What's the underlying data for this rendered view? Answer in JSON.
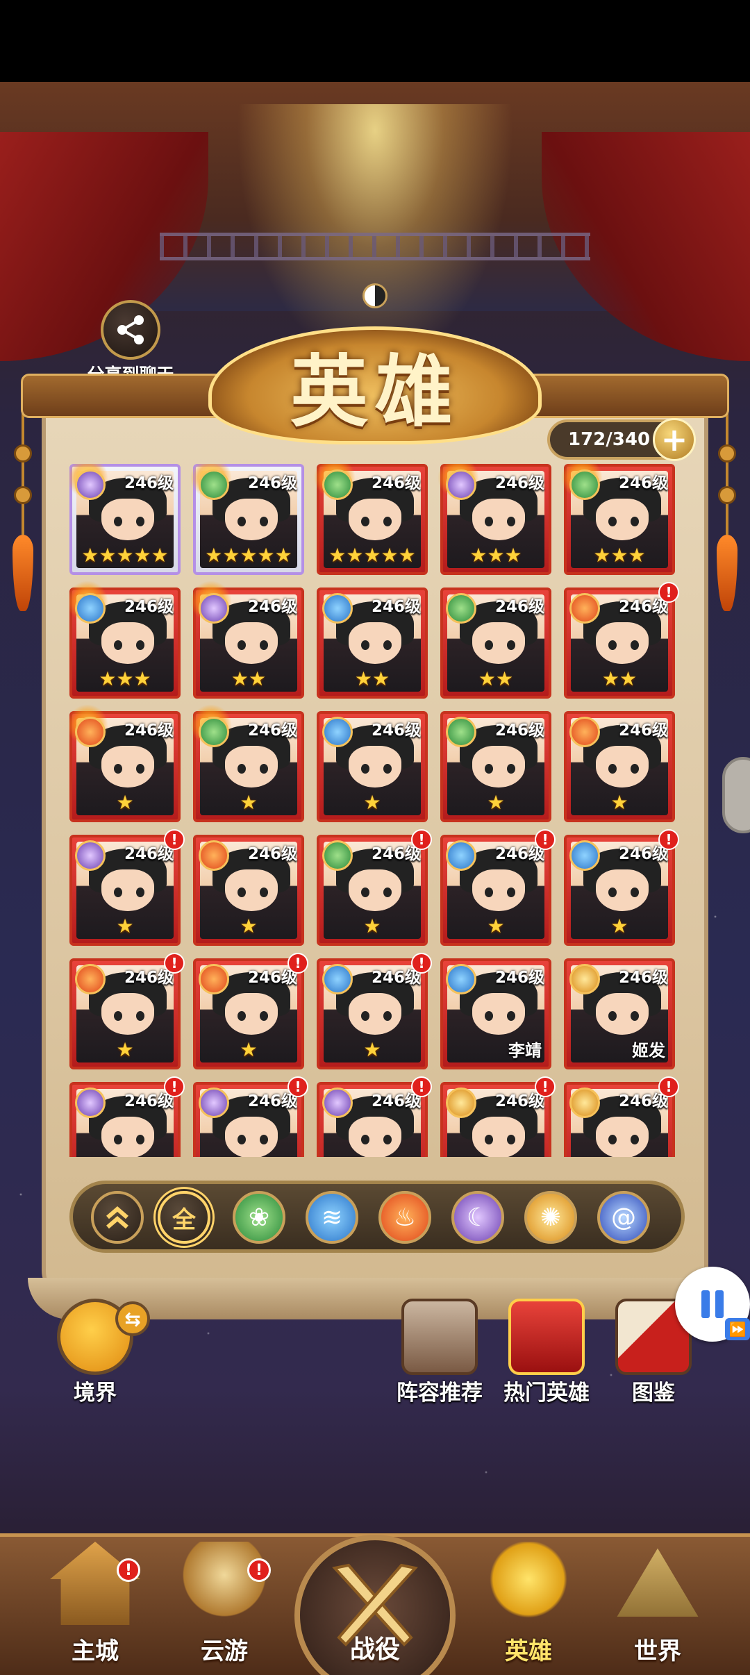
{
  "share": {
    "label": "分享到聊天",
    "icon": "share-icon"
  },
  "title": "英雄",
  "hero_count": "172/340",
  "add_icon": "plus-icon",
  "heroes": [
    {
      "level": "246级",
      "element": "moon",
      "stars": "★★★★★",
      "rarity": "pink",
      "flame": true,
      "alert": false,
      "name": ""
    },
    {
      "level": "246级",
      "element": "wood",
      "stars": "★★★★★",
      "rarity": "pink",
      "flame": true,
      "alert": false,
      "name": ""
    },
    {
      "level": "246级",
      "element": "wood",
      "stars": "★★★★★",
      "rarity": "red",
      "flame": true,
      "alert": false,
      "name": ""
    },
    {
      "level": "246级",
      "element": "moon",
      "stars": "★★★",
      "rarity": "red",
      "flame": true,
      "alert": false,
      "name": ""
    },
    {
      "level": "246级",
      "element": "wood",
      "stars": "★★★",
      "rarity": "red",
      "flame": true,
      "alert": false,
      "name": ""
    },
    {
      "level": "246级",
      "element": "water",
      "stars": "★★★",
      "rarity": "red",
      "flame": true,
      "alert": false,
      "name": ""
    },
    {
      "level": "246级",
      "element": "moon",
      "stars": "★★",
      "rarity": "red",
      "flame": true,
      "alert": false,
      "name": ""
    },
    {
      "level": "246级",
      "element": "water",
      "stars": "★★",
      "rarity": "red",
      "flame": false,
      "alert": false,
      "name": ""
    },
    {
      "level": "246级",
      "element": "wood",
      "stars": "★★",
      "rarity": "red",
      "flame": false,
      "alert": false,
      "name": ""
    },
    {
      "level": "246级",
      "element": "fire",
      "stars": "★★",
      "rarity": "red",
      "flame": false,
      "alert": true,
      "name": ""
    },
    {
      "level": "246级",
      "element": "fire",
      "stars": "★",
      "rarity": "red",
      "flame": true,
      "alert": false,
      "name": ""
    },
    {
      "level": "246级",
      "element": "wood",
      "stars": "★",
      "rarity": "red",
      "flame": true,
      "alert": false,
      "name": ""
    },
    {
      "level": "246级",
      "element": "water",
      "stars": "★",
      "rarity": "red",
      "flame": false,
      "alert": false,
      "name": ""
    },
    {
      "level": "246级",
      "element": "wood",
      "stars": "★",
      "rarity": "red",
      "flame": false,
      "alert": false,
      "name": ""
    },
    {
      "level": "246级",
      "element": "fire",
      "stars": "★",
      "rarity": "red",
      "flame": false,
      "alert": false,
      "name": ""
    },
    {
      "level": "246级",
      "element": "moon",
      "stars": "★",
      "rarity": "red",
      "flame": false,
      "alert": true,
      "name": ""
    },
    {
      "level": "246级",
      "element": "fire",
      "stars": "★",
      "rarity": "red",
      "flame": false,
      "alert": false,
      "name": ""
    },
    {
      "level": "246级",
      "element": "wood",
      "stars": "★",
      "rarity": "red",
      "flame": false,
      "alert": true,
      "name": ""
    },
    {
      "level": "246级",
      "element": "water",
      "stars": "★",
      "rarity": "red",
      "flame": false,
      "alert": true,
      "name": ""
    },
    {
      "level": "246级",
      "element": "water",
      "stars": "★",
      "rarity": "red",
      "flame": false,
      "alert": true,
      "name": ""
    },
    {
      "level": "246级",
      "element": "fire",
      "stars": "★",
      "rarity": "red",
      "flame": false,
      "alert": true,
      "name": ""
    },
    {
      "level": "246级",
      "element": "fire",
      "stars": "★",
      "rarity": "red",
      "flame": false,
      "alert": true,
      "name": ""
    },
    {
      "level": "246级",
      "element": "water",
      "stars": "★",
      "rarity": "red",
      "flame": false,
      "alert": true,
      "name": ""
    },
    {
      "level": "246级",
      "element": "water",
      "stars": "",
      "rarity": "red",
      "flame": false,
      "alert": false,
      "name": "李靖"
    },
    {
      "level": "246级",
      "element": "sun",
      "stars": "",
      "rarity": "red",
      "flame": false,
      "alert": false,
      "name": "姬发"
    },
    {
      "level": "246级",
      "element": "moon",
      "stars": "",
      "rarity": "red",
      "flame": false,
      "alert": true,
      "name": ""
    },
    {
      "level": "246级",
      "element": "moon",
      "stars": "",
      "rarity": "red",
      "flame": false,
      "alert": true,
      "name": ""
    },
    {
      "level": "246级",
      "element": "moon",
      "stars": "",
      "rarity": "red",
      "flame": false,
      "alert": true,
      "name": ""
    },
    {
      "level": "246级",
      "element": "sun",
      "stars": "",
      "rarity": "red",
      "flame": false,
      "alert": true,
      "name": ""
    },
    {
      "level": "246级",
      "element": "sun",
      "stars": "",
      "rarity": "red",
      "flame": false,
      "alert": true,
      "name": ""
    }
  ],
  "filters": {
    "sort_icon": "double-chevron-up-icon",
    "all_label": "全",
    "elements": [
      {
        "name": "wood",
        "icon": "leaf-icon",
        "glyph": "❀"
      },
      {
        "name": "water",
        "icon": "wave-icon",
        "glyph": "≋"
      },
      {
        "name": "fire",
        "icon": "flame-icon",
        "glyph": "♨"
      },
      {
        "name": "moon",
        "icon": "moon-icon",
        "glyph": "☾"
      },
      {
        "name": "sun",
        "icon": "sun-icon",
        "glyph": "✺"
      },
      {
        "name": "wind",
        "icon": "swirl-icon",
        "glyph": "@"
      }
    ]
  },
  "side_menu": {
    "realm": "境界",
    "lineup": "阵容推荐",
    "hot_heroes": "热门英雄",
    "codex": "图鉴"
  },
  "nav": {
    "city": "主城",
    "travel": "云游",
    "battle": "战役",
    "heroes": "英雄",
    "world": "世界",
    "badge": "!"
  },
  "colors": {
    "card_red": "#d8352c",
    "card_pink": "#b48fe6",
    "gold": "#ffd23a",
    "alert": "#e0201c"
  }
}
